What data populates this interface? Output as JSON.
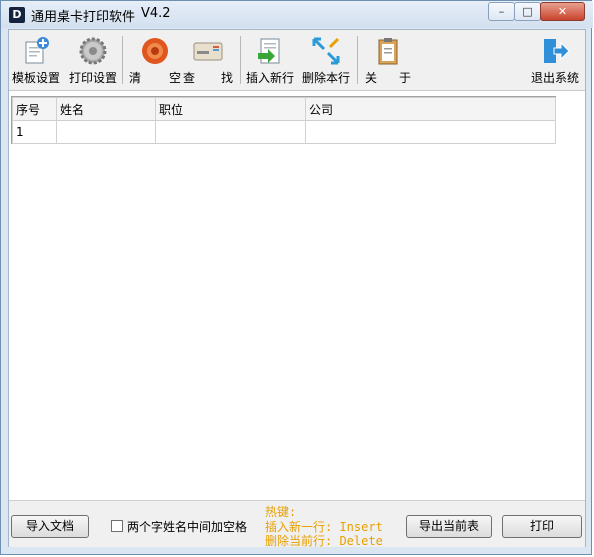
{
  "window": {
    "title": "通用桌卡打印软件",
    "version": "V4.2"
  },
  "window_controls": {
    "minimize": "–",
    "maximize": "□",
    "close": "✕"
  },
  "toolbar": {
    "template": "模板设置",
    "print_settings": "打印设置",
    "clear_a": "清",
    "clear_b": "空",
    "find_a": "查",
    "find_b": "找",
    "insert_row": "插入新行",
    "delete_row": "删除本行",
    "about_a": "关",
    "about_b": "于",
    "exit": "退出系统"
  },
  "table": {
    "headers": [
      "序号",
      "姓名",
      "职位",
      "公司"
    ],
    "rows": [
      [
        "1",
        "",
        "",
        ""
      ]
    ]
  },
  "bottom": {
    "import": "导入文档",
    "checkbox_label": "两个字姓名中间加空格",
    "checkbox_checked": false,
    "hotkey_title": "热键:",
    "hotkey_insert": "插入新一行: Insert",
    "hotkey_delete": "删除当前行: Delete",
    "export": "导出当前表",
    "print": "打印"
  },
  "colors": {
    "hotkey": "#e8a000",
    "titlebar": "#dbe6f3"
  }
}
